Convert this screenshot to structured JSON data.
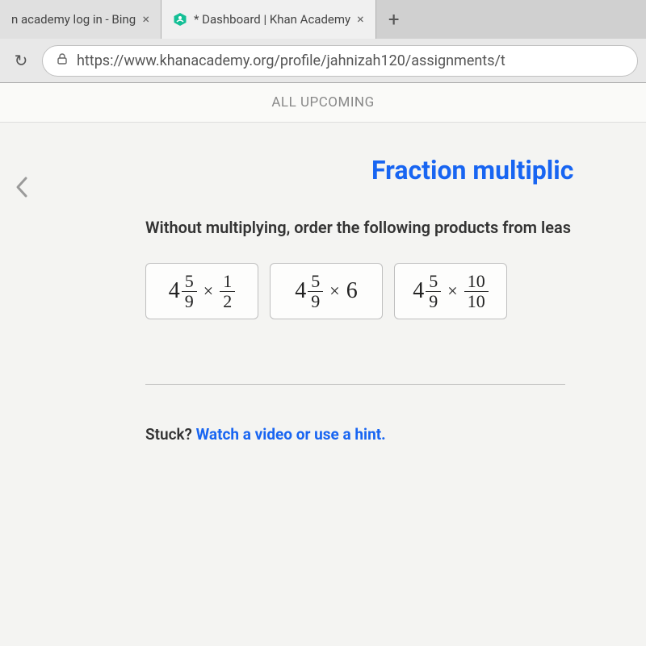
{
  "browser": {
    "tabs": [
      {
        "title": "n academy log in - Bing",
        "active": false
      },
      {
        "title": "* Dashboard | Khan Academy",
        "active": true
      }
    ],
    "new_tab_glyph": "+",
    "close_glyph": "×",
    "reload_glyph": "↻",
    "url": "https://www.khanacademy.org/profile/jahnizah120/assignments/t"
  },
  "page": {
    "nav_label": "ALL UPCOMING",
    "title": "Fraction multiplic",
    "question": "Without multiplying, order the following products from leas",
    "tiles": [
      {
        "whole": "4",
        "num": "5",
        "den": "9",
        "op": "×",
        "mult_type": "fraction",
        "mult_num": "1",
        "mult_den": "2"
      },
      {
        "whole": "4",
        "num": "5",
        "den": "9",
        "op": "×",
        "mult_type": "whole",
        "mult_whole": "6"
      },
      {
        "whole": "4",
        "num": "5",
        "den": "9",
        "op": "×",
        "mult_type": "fraction",
        "mult_num": "10",
        "mult_den": "10"
      }
    ],
    "stuck_label": "Stuck? ",
    "stuck_link": "Watch a video or use a hint."
  }
}
